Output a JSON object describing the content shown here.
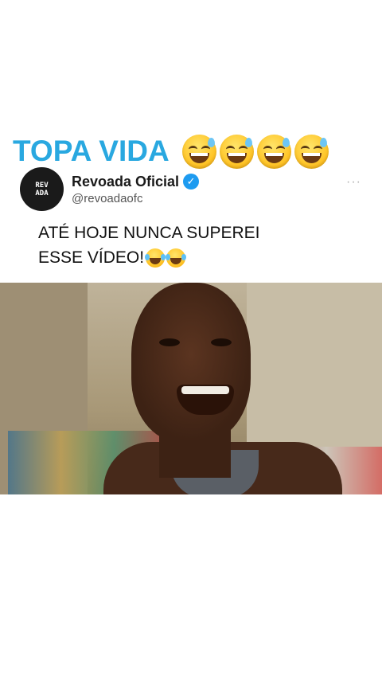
{
  "headline": {
    "text": "TOPA VIDA",
    "emoji_count": 4,
    "emoji_icon": "grinning-sweat-face-icon"
  },
  "tweet": {
    "avatar_text": "REV\nADA",
    "display_name": "Revoada Oficial",
    "verified": true,
    "handle": "@revoadaofc",
    "more_label": "···",
    "text_line1": "ATÉ HOJE NUNCA SUPEREI",
    "text_line2": "ESSE VÍDEO!",
    "trailing_emoji": [
      "tears-of-joy-icon",
      "tears-of-joy-icon"
    ]
  },
  "colors": {
    "headline": "#29a8e0",
    "verified_badge": "#1d9bf0",
    "background": "#ffffff"
  },
  "video": {
    "icon": "video-frame-smiling-person"
  }
}
